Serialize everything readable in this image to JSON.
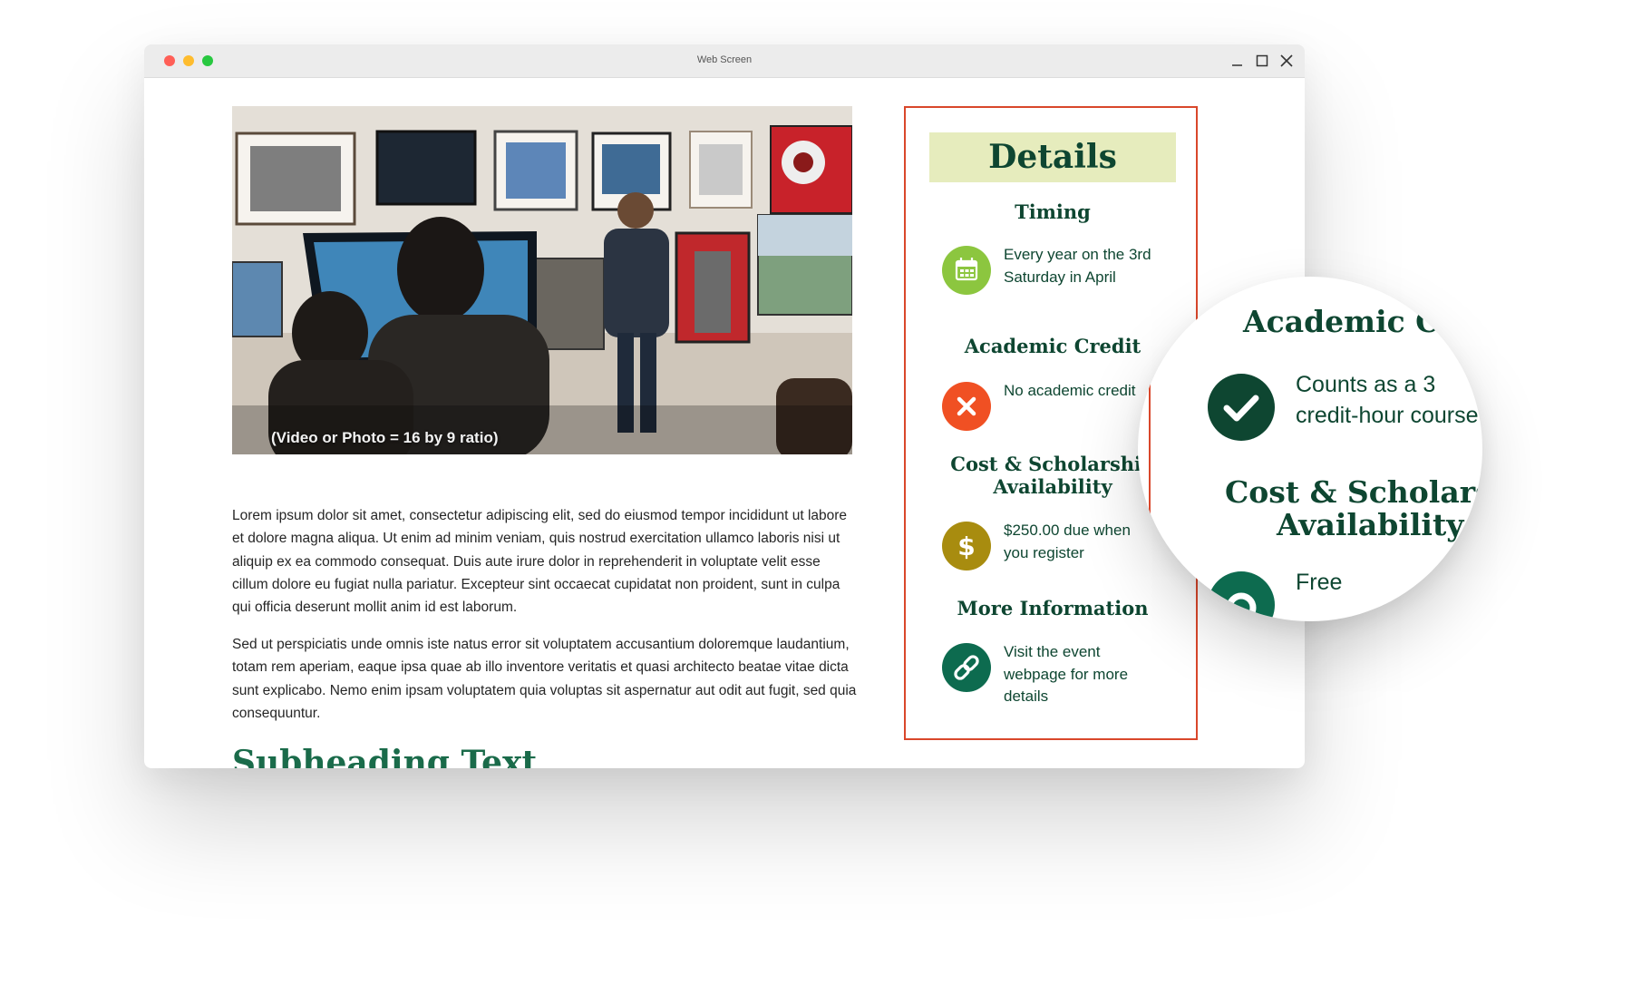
{
  "window": {
    "title": "Web Screen"
  },
  "hero": {
    "caption": "(Video or Photo = 16 by 9 ratio)"
  },
  "content": {
    "paragraphs": [
      "Lorem ipsum dolor sit amet, consectetur adipiscing elit, sed do eiusmod tempor incididunt ut labore et dolore magna aliqua. Ut enim ad minim veniam, quis nostrud exercitation ullamco laboris nisi ut aliquip ex ea commodo consequat. Duis aute irure dolor in reprehenderit in voluptate velit esse cillum dolore eu fugiat nulla pariatur. Excepteur sint occaecat cupidatat non proident, sunt in culpa qui officia deserunt mollit anim id est laborum.",
      "Sed ut perspiciatis unde omnis iste natus error sit voluptatem accusantium doloremque laudantium, totam rem aperiam, eaque ipsa quae ab illo inventore veritatis et quasi architecto beatae vitae dicta sunt explicabo. Nemo enim ipsam voluptatem quia voluptas sit aspernatur aut odit aut fugit, sed quia consequuntur."
    ],
    "subheading": "Subheading Text"
  },
  "details": {
    "heading": "Details",
    "sections": [
      {
        "title": "Timing",
        "icon": "calendar-icon",
        "color": "#8cc63f",
        "text": "Every year on the 3rd Saturday in April"
      },
      {
        "title": "Academic Credit",
        "icon": "x-icon",
        "color": "#f05023",
        "text": "No academic credit"
      },
      {
        "title": "Cost & Scholarship Availability",
        "icon": "dollar-icon",
        "color": "#a88c0f",
        "text": "$250.00 due when you register"
      },
      {
        "title": "More Information",
        "icon": "link-icon",
        "color": "#0d6b4f",
        "text": "Visit the event webpage for more details"
      }
    ]
  },
  "magnifier": {
    "credit_title": "Academic Credit",
    "credit_icon": "check-icon",
    "credit_icon_color": "#0e4631",
    "credit_text_line1": "Counts as a 3",
    "credit_text_line2": "credit-hour course",
    "cost_title_line1": "Cost & Scholarship",
    "cost_title_line2": "Availability",
    "cost_icon": "dollar-icon",
    "cost_icon_color": "#0d6b4f",
    "cost_text": "Free"
  },
  "colors": {
    "accent_green": "#0e4631",
    "border_red": "#d9472b",
    "heading_bg": "#e6ecbd"
  }
}
